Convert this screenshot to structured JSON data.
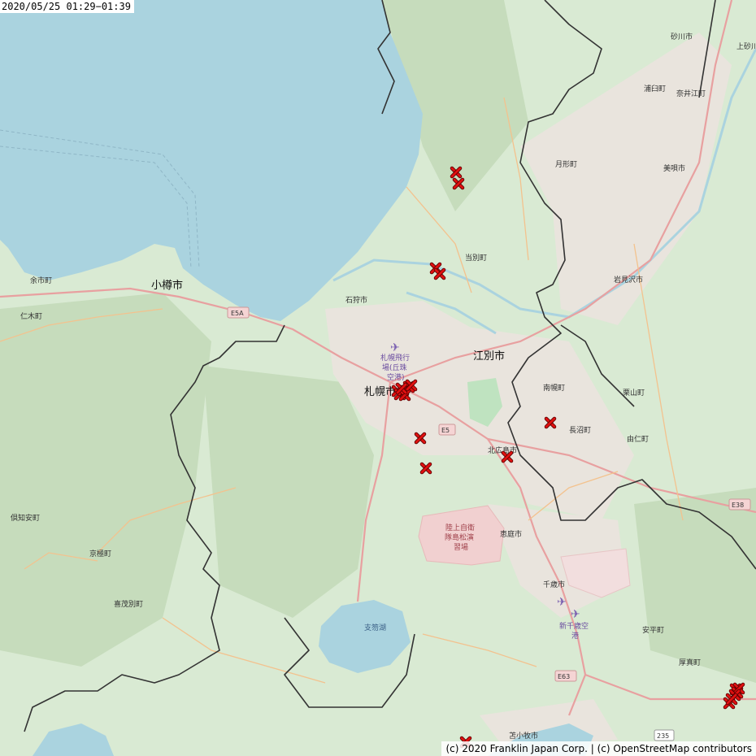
{
  "timestamp": "2020/05/25 01:29−01:39",
  "attribution": "(c) 2020 Franklin Japan Corp. | (c) OpenStreetMap contributors",
  "colors": {
    "sea": "#aad3df",
    "land": "#d9ead3",
    "forest": "#c8dfbf",
    "urban": "#e8e3dc",
    "road_major": "#e8a0a0",
    "road_minor": "#f6c99a",
    "boundary": "#333333",
    "strike_marker": "#e01010"
  },
  "marker_icon": "x-mark",
  "places": [
    {
      "id": "sapporo",
      "label": "札幌市",
      "size": "big"
    },
    {
      "id": "ebetsu",
      "label": "江別市",
      "size": "big"
    },
    {
      "id": "otaru",
      "label": "小樽市",
      "size": "big"
    },
    {
      "id": "ishikari",
      "label": "石狩市",
      "size": "small"
    },
    {
      "id": "tobetsu",
      "label": "当別町",
      "size": "small"
    },
    {
      "id": "sunagawa",
      "label": "砂川市",
      "size": "small"
    },
    {
      "id": "kamisunagawa",
      "label": "上砂川",
      "size": "small"
    },
    {
      "id": "urausu",
      "label": "浦臼町",
      "size": "small"
    },
    {
      "id": "naie",
      "label": "奈井江町",
      "size": "small"
    },
    {
      "id": "tsukigata",
      "label": "月形町",
      "size": "small"
    },
    {
      "id": "bibai",
      "label": "美唄市",
      "size": "small"
    },
    {
      "id": "iwamizawa",
      "label": "岩見沢市",
      "size": "small"
    },
    {
      "id": "nanporo",
      "label": "南幌町",
      "size": "small"
    },
    {
      "id": "naganuma",
      "label": "長沼町",
      "size": "small"
    },
    {
      "id": "kuriyama",
      "label": "栗山町",
      "size": "small"
    },
    {
      "id": "yuni",
      "label": "由仁町",
      "size": "small"
    },
    {
      "id": "kitahiroshima",
      "label": "北広島市",
      "size": "small"
    },
    {
      "id": "eniwa",
      "label": "恵庭市",
      "size": "small"
    },
    {
      "id": "chitose",
      "label": "千歳市",
      "size": "small"
    },
    {
      "id": "abira",
      "label": "安平町",
      "size": "small"
    },
    {
      "id": "atsuma",
      "label": "厚真町",
      "size": "small"
    },
    {
      "id": "tomakomai",
      "label": "苫小牧市",
      "size": "small"
    },
    {
      "id": "yoichi",
      "label": "余市町",
      "size": "small"
    },
    {
      "id": "niki",
      "label": "仁木町",
      "size": "small"
    },
    {
      "id": "kutchan",
      "label": "倶知安町",
      "size": "small"
    },
    {
      "id": "kyogoku",
      "label": "京極町",
      "size": "small"
    },
    {
      "id": "kimobetsu",
      "label": "喜茂別町",
      "size": "small"
    }
  ],
  "features": {
    "lake": "支笏湖",
    "airport_okadama": [
      "札幌飛行",
      "場(丘珠",
      "空港)"
    ],
    "airport_newchitose": [
      "新千歳空",
      "港"
    ],
    "training_area": [
      "陸上自衛",
      "隊島松演",
      "習場"
    ]
  },
  "road_shields": [
    "E5A",
    "E5",
    "E38",
    "E63",
    "235"
  ],
  "strike_count": 22
}
